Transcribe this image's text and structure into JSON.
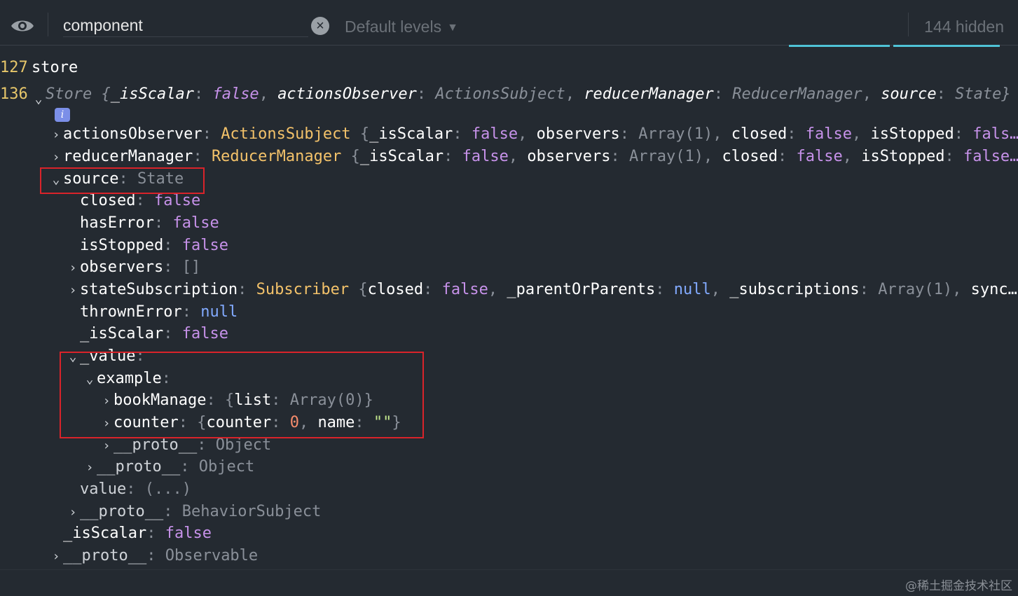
{
  "toolbar": {
    "filter_value": "component",
    "clear_symbol": "×",
    "levels_label": "Default levels",
    "levels_caret": "▼",
    "hidden_count": "144 hidden"
  },
  "console": {
    "log_store": {
      "line": "127",
      "text": "store"
    },
    "store_obj": {
      "line": "136",
      "collapsed_preview": {
        "class": "Store",
        "open": "{",
        "k1": "_isScalar",
        "v1": "false",
        "k2": "actionsObserver",
        "v2": "ActionsSubject",
        "k3": "reducerManager",
        "v3": "ReducerManager",
        "k4": "source",
        "v4": "State",
        "close": "}"
      },
      "info_badge": "i"
    },
    "rows": {
      "actionsObserver": {
        "key": "actionsObserver",
        "cls": "ActionsSubject",
        "p1k": "_isScalar",
        "p1v": "false",
        "p2k": "observers",
        "p2v": "Array(1)",
        "p3k": "closed",
        "p3v": "false",
        "p4k": "isStopped",
        "p4v": "fals…"
      },
      "reducerManager": {
        "key": "reducerManager",
        "cls": "ReducerManager",
        "p1k": "_isScalar",
        "p1v": "false",
        "p2k": "observers",
        "p2v": "Array(1)",
        "p3k": "closed",
        "p3v": "false",
        "p4k": "isStopped",
        "p4v": "false…"
      },
      "source": {
        "key": "source",
        "val": "State"
      },
      "closed": {
        "key": "closed",
        "val": "false"
      },
      "hasError": {
        "key": "hasError",
        "val": "false"
      },
      "isStopped": {
        "key": "isStopped",
        "val": "false"
      },
      "observers": {
        "key": "observers",
        "val": "[]"
      },
      "stateSubscription": {
        "key": "stateSubscription",
        "cls": "Subscriber",
        "p1k": "closed",
        "p1v": "false",
        "p2k": "_parentOrParents",
        "p2v": "null",
        "p3k": "_subscriptions",
        "p3v": "Array(1)",
        "p4k": "sync…"
      },
      "thrownError": {
        "key": "thrownError",
        "val": "null"
      },
      "isScalar_inner": {
        "key": "_isScalar",
        "val": "false"
      },
      "value_expanded": {
        "key": "_value"
      },
      "example": {
        "key": "example"
      },
      "bookManage": {
        "key": "bookManage",
        "p1k": "list",
        "p1v": "Array(0)"
      },
      "counter": {
        "key": "counter",
        "p1k": "counter",
        "p1v": "0",
        "p2k": "name",
        "p2v": "\"\""
      },
      "proto_example": {
        "key": "__proto__",
        "val": "Object"
      },
      "proto_value": {
        "key": "__proto__",
        "val": "Object"
      },
      "value_getter": {
        "key": "value",
        "val": "(...)"
      },
      "proto_source": {
        "key": "__proto__",
        "val": "BehaviorSubject"
      },
      "isScalar_outer": {
        "key": "_isScalar",
        "val": "false"
      },
      "proto_store": {
        "key": "__proto__",
        "val": "Observable"
      }
    }
  },
  "footer": {
    "watermark": "@稀土掘金技术社区"
  }
}
